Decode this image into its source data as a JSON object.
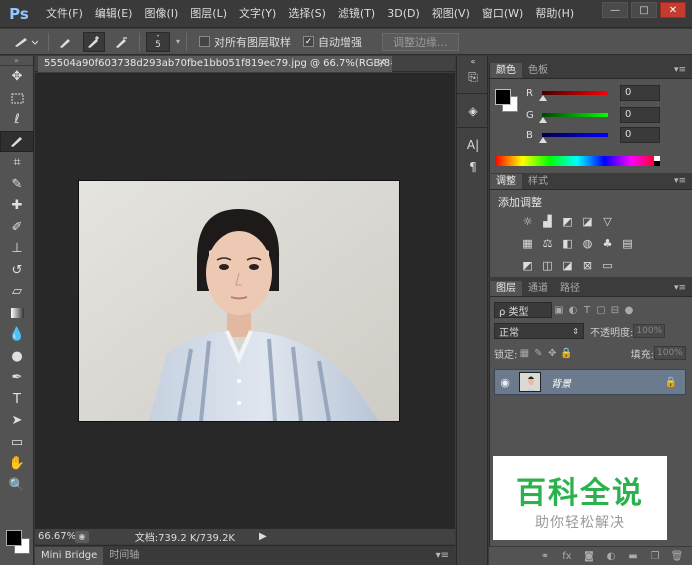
{
  "app": {
    "logo": "Ps",
    "menus": [
      "文件(F)",
      "编辑(E)",
      "图像(I)",
      "图层(L)",
      "文字(Y)",
      "选择(S)",
      "滤镜(T)",
      "3D(D)",
      "视图(V)",
      "窗口(W)",
      "帮助(H)"
    ],
    "window_controls": [
      "—",
      "□",
      "✕"
    ]
  },
  "options": {
    "brush_size": "5",
    "sample_all_layers_label": "对所有图层取样",
    "sample_all_layers_checked": false,
    "auto_enhance_label": "自动增强",
    "auto_enhance_checked": true,
    "refine_edge_label": "调整边缘..."
  },
  "document": {
    "tab_title": "55504a90f603738d293ab70fbe1bb051f819ec79.jpg @ 66.7%(RGB/8#) *",
    "close_glyph": "×",
    "zoom": "66.67%",
    "doc_info": "文档:739.2 K/739.2K"
  },
  "bottom_tabs": [
    "Mini Bridge",
    "时间轴"
  ],
  "color_panel": {
    "tabs": [
      "颜色",
      "色板"
    ],
    "sliders": [
      {
        "label": "R",
        "value": "0",
        "color": "#d01010"
      },
      {
        "label": "G",
        "value": "0",
        "color": "#10b010"
      },
      {
        "label": "B",
        "value": "0",
        "color": "#1010d0"
      }
    ]
  },
  "adjustments_panel": {
    "tabs": [
      "调整",
      "样式"
    ],
    "title": "添加调整"
  },
  "layers_panel": {
    "tabs": [
      "图层",
      "通道",
      "路径"
    ],
    "filter_label": "ρ 类型",
    "blend_mode": "正常",
    "opacity_label": "不透明度:",
    "opacity_value": "100%",
    "lock_label": "锁定:",
    "fill_label": "填充:",
    "fill_value": "100%",
    "layer_name": "背景"
  },
  "watermark": {
    "title": "百科全说",
    "subtitle": "助你轻松解决"
  }
}
